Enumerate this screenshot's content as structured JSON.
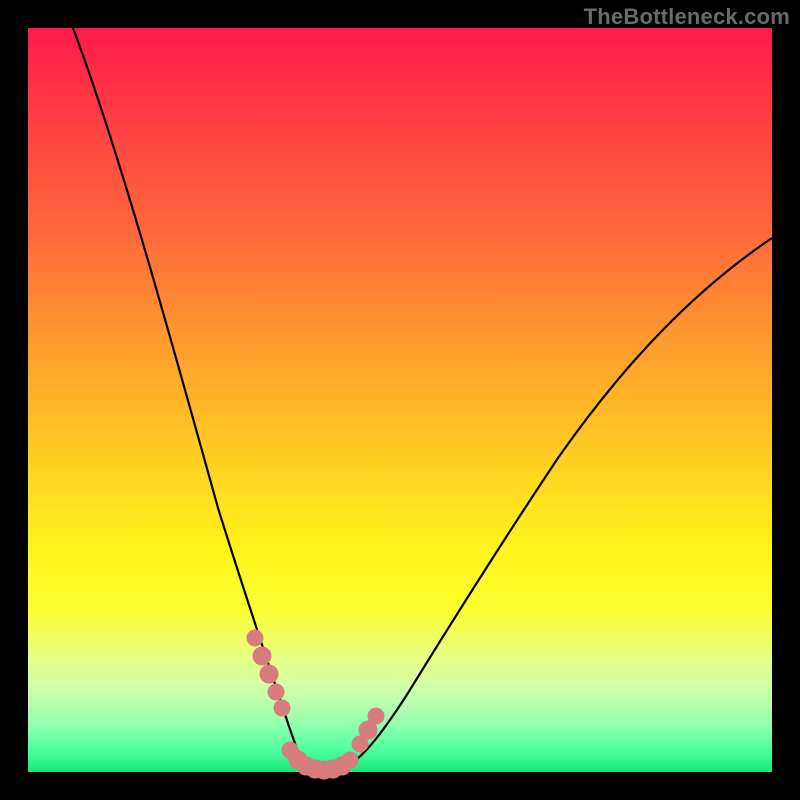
{
  "watermark": "TheBottleneck.com",
  "chart_data": {
    "type": "line",
    "title": "",
    "xlabel": "",
    "ylabel": "",
    "xlim": [
      0,
      100
    ],
    "ylim": [
      0,
      100
    ],
    "gradient_stops": [
      {
        "pos": 0,
        "color": "#ff1a4b"
      },
      {
        "pos": 12,
        "color": "#ff3e43"
      },
      {
        "pos": 28,
        "color": "#ff6a3a"
      },
      {
        "pos": 42,
        "color": "#ff9a2e"
      },
      {
        "pos": 56,
        "color": "#ffc924"
      },
      {
        "pos": 70,
        "color": "#fff41a"
      },
      {
        "pos": 78,
        "color": "#fbff30"
      },
      {
        "pos": 82,
        "color": "#f0ff62"
      },
      {
        "pos": 85,
        "color": "#e6ff88"
      },
      {
        "pos": 88,
        "color": "#d4ffa2"
      },
      {
        "pos": 91,
        "color": "#b7ffb0"
      },
      {
        "pos": 94,
        "color": "#8affad"
      },
      {
        "pos": 97,
        "color": "#4eff9f"
      },
      {
        "pos": 100,
        "color": "#17e878"
      }
    ],
    "series": [
      {
        "name": "left-curve",
        "x": [
          6,
          10,
          14,
          18,
          22,
          25,
          28,
          30,
          32,
          34,
          36
        ],
        "y": [
          100,
          80,
          62,
          46,
          32,
          22,
          14,
          8,
          4,
          1,
          0
        ]
      },
      {
        "name": "right-curve",
        "x": [
          42,
          45,
          50,
          56,
          64,
          74,
          86,
          100
        ],
        "y": [
          0,
          3,
          9,
          18,
          30,
          44,
          58,
          72
        ]
      },
      {
        "name": "valley-floor",
        "x": [
          36,
          38,
          40,
          42
        ],
        "y": [
          0,
          0,
          0,
          0
        ]
      }
    ],
    "marker_clusters": [
      {
        "name": "left-markers",
        "cx": 30,
        "cy": 10,
        "points": [
          [
            28,
            14
          ],
          [
            29,
            11
          ],
          [
            30,
            8
          ],
          [
            31,
            6
          ],
          [
            32,
            4
          ]
        ]
      },
      {
        "name": "right-markers",
        "cx": 44,
        "cy": 5,
        "points": [
          [
            43,
            2
          ],
          [
            44,
            4
          ],
          [
            45,
            6
          ]
        ]
      },
      {
        "name": "bottom-markers",
        "cx": 38,
        "cy": 0,
        "points": [
          [
            34,
            0.5
          ],
          [
            35,
            0.3
          ],
          [
            36,
            0.1
          ],
          [
            37,
            0
          ],
          [
            38,
            0
          ],
          [
            39,
            0
          ],
          [
            40,
            0.1
          ],
          [
            41,
            0.3
          ],
          [
            42,
            0.6
          ]
        ]
      }
    ],
    "marker_color": "#d77d7d"
  }
}
